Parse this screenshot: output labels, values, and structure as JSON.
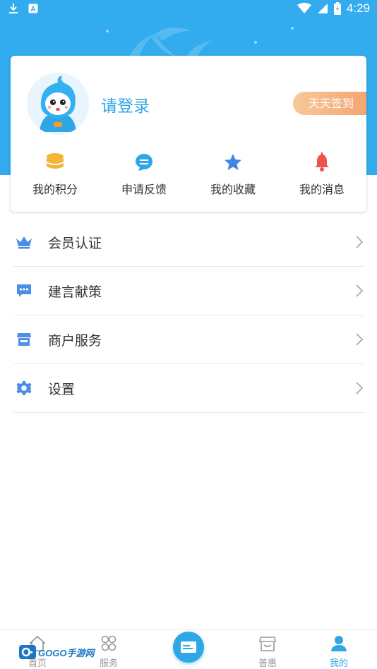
{
  "status_bar": {
    "time": "4:29",
    "left_icons": [
      "download-icon",
      "a-icon"
    ],
    "right_icons": [
      "wifi-icon",
      "signal-icon",
      "battery-icon"
    ]
  },
  "profile": {
    "login_text": "请登录",
    "signin_button": "天天签到"
  },
  "quick_actions": [
    {
      "label": "我的积分",
      "icon": "coins-icon",
      "color": "#f2b535"
    },
    {
      "label": "申请反馈",
      "icon": "chat-icon",
      "color": "#2fa7e6"
    },
    {
      "label": "我的收藏",
      "icon": "star-icon",
      "color": "#3f86e6"
    },
    {
      "label": "我的消息",
      "icon": "bell-icon",
      "color": "#ef5350"
    }
  ],
  "menu": [
    {
      "label": "会员认证",
      "icon": "crown-icon"
    },
    {
      "label": "建言献策",
      "icon": "message-icon"
    },
    {
      "label": "商户服务",
      "icon": "store-icon"
    },
    {
      "label": "设置",
      "icon": "gear-icon"
    }
  ],
  "tab_bar": {
    "tabs": [
      {
        "label": "首页",
        "icon": "home-icon"
      },
      {
        "label": "服务",
        "icon": "grid-icon"
      },
      {
        "label": "普惠",
        "icon": "shop-icon"
      },
      {
        "label": "我的",
        "icon": "user-icon"
      }
    ],
    "active": "我的"
  },
  "watermark": {
    "text": "GOGO手游网"
  },
  "colors": {
    "primary": "#2fa7e6",
    "header_bg": "#32acef",
    "signin_gradient": [
      "#f7c99a",
      "#f3a46e"
    ]
  }
}
